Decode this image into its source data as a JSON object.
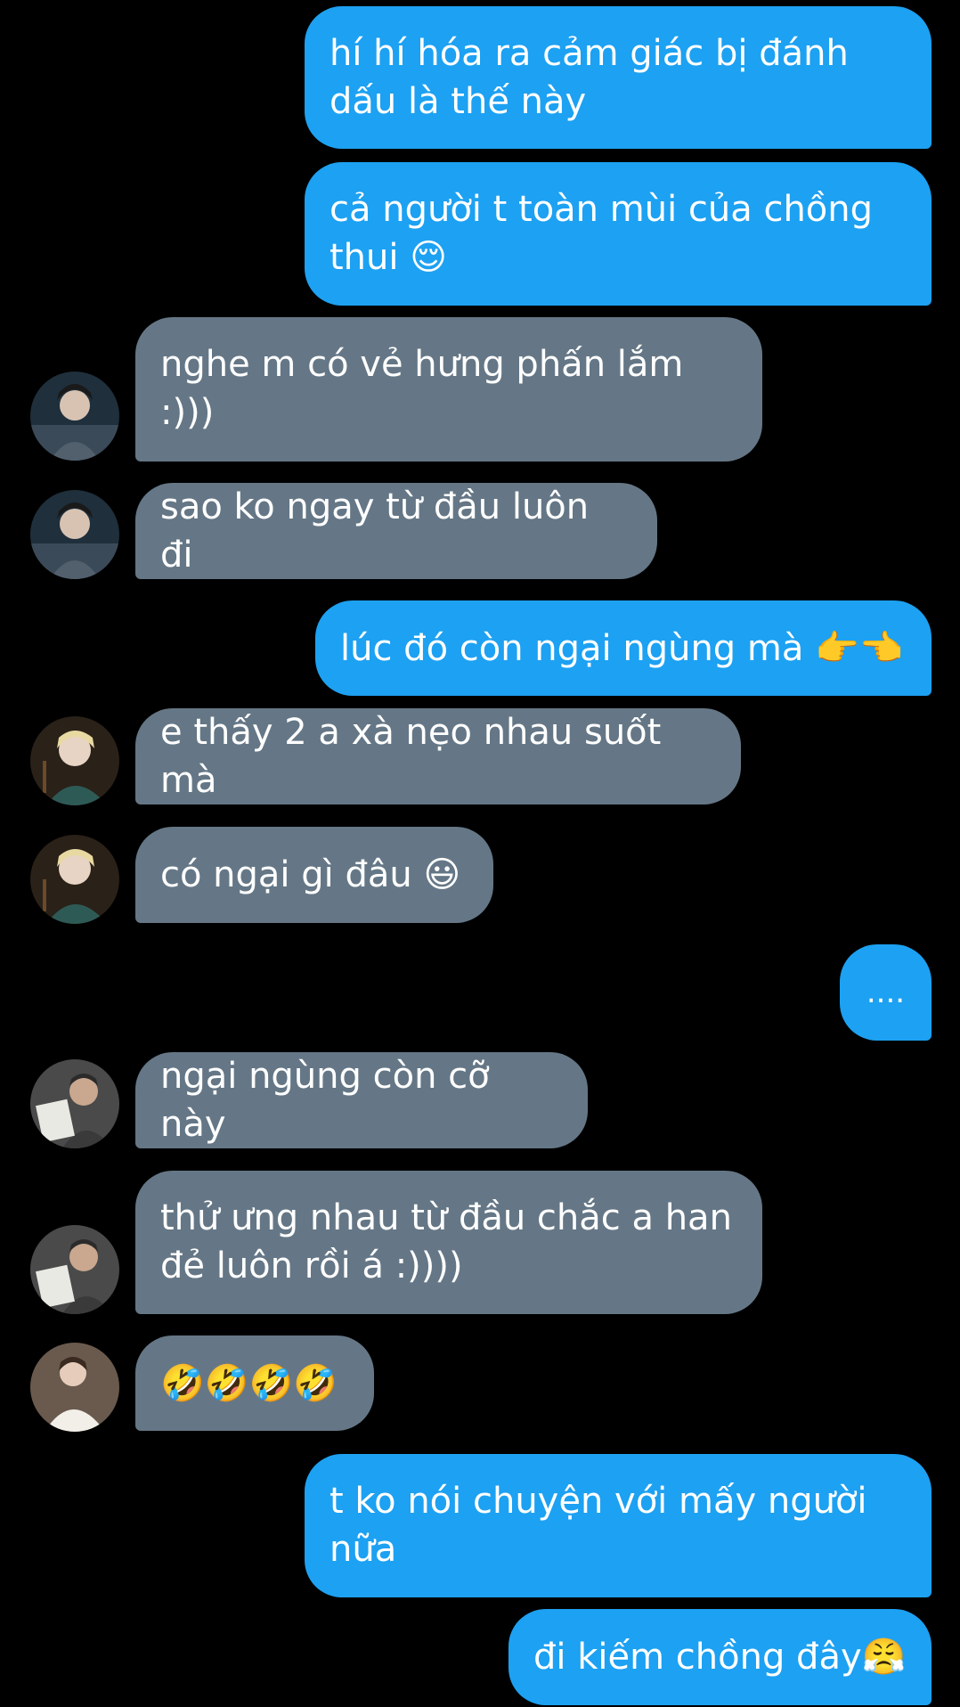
{
  "colors": {
    "background": "#000000",
    "sent_bubble": "#1da1f2",
    "received_bubble": "#657786",
    "text": "#ffffff"
  },
  "messages": [
    {
      "from": "me",
      "text": "hí hí hóa ra cảm giác bị đánh dấu là thế này"
    },
    {
      "from": "me",
      "text": "cả người t toàn mùi của chồng thui 😌"
    },
    {
      "from": "user1",
      "avatar": "avatar-dark-jersey",
      "text": "nghe m có vẻ hưng phấn lắm :)))"
    },
    {
      "from": "user1",
      "avatar": "avatar-dark-jersey",
      "text": "sao ko ngay từ đầu luôn đi"
    },
    {
      "from": "me",
      "text": "lúc đó còn ngại ngùng mà 👉👈"
    },
    {
      "from": "user2",
      "avatar": "avatar-blonde-backpack",
      "text": "e thấy 2 a xà nẹo nhau suốt mà"
    },
    {
      "from": "user2",
      "avatar": "avatar-blonde-backpack",
      "text": "có ngại gì đâu 😃"
    },
    {
      "from": "me",
      "text": "...."
    },
    {
      "from": "user3",
      "avatar": "avatar-reading-paper",
      "text": "ngại ngùng còn cỡ này"
    },
    {
      "from": "user3",
      "avatar": "avatar-reading-paper",
      "text": "thử ưng nhau từ đầu chắc a han đẻ luôn rồi á :))))"
    },
    {
      "from": "user4",
      "avatar": "avatar-white-shirt",
      "text": "🤣🤣🤣🤣"
    },
    {
      "from": "me",
      "text": "t ko nói chuyện với mấy người nữa"
    },
    {
      "from": "me",
      "text": "đi kiếm chồng đây😤"
    }
  ]
}
